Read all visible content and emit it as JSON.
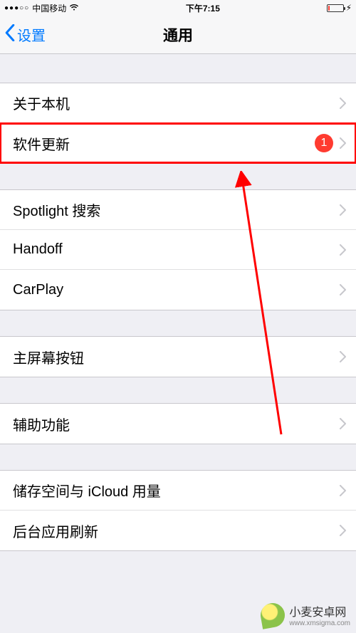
{
  "statusbar": {
    "signal_dots": "●●●○○",
    "carrier": "中国移动",
    "time": "下午7:15",
    "charging": "⚡︎"
  },
  "nav": {
    "back_label": "设置",
    "title": "通用"
  },
  "groups": [
    {
      "items": [
        {
          "label": "关于本机",
          "name": "cell-about"
        },
        {
          "label": "软件更新",
          "name": "cell-software-update",
          "badge": "1",
          "highlight": true
        }
      ]
    },
    {
      "items": [
        {
          "label": "Spotlight 搜索",
          "name": "cell-spotlight"
        },
        {
          "label": "Handoff",
          "name": "cell-handoff"
        },
        {
          "label": "CarPlay",
          "name": "cell-carplay"
        }
      ]
    },
    {
      "items": [
        {
          "label": "主屏幕按钮",
          "name": "cell-home-button"
        }
      ]
    },
    {
      "items": [
        {
          "label": "辅助功能",
          "name": "cell-accessibility"
        }
      ]
    },
    {
      "items": [
        {
          "label": "储存空间与 iCloud 用量",
          "name": "cell-storage-icloud"
        },
        {
          "label": "后台应用刷新",
          "name": "cell-background-refresh"
        }
      ]
    }
  ],
  "watermark": {
    "brand": "小麦安卓网",
    "url": "www.xmsigma.com"
  }
}
